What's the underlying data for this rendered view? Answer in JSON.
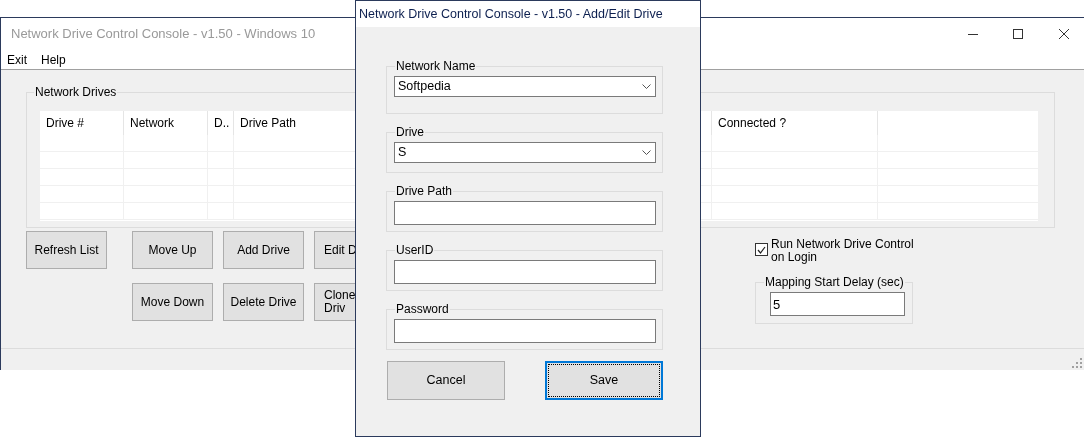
{
  "main_window": {
    "title": "Network Drive Control Console - v1.50 - Windows 10",
    "menu": [
      "Exit",
      "Help"
    ],
    "drives_group": {
      "title": "Network Drives",
      "table": {
        "columns": [
          "Drive #",
          "Network",
          "D..",
          "Drive Path",
          "Connected ?"
        ]
      }
    },
    "buttons": [
      {
        "label": "Refresh List"
      },
      {
        "label": "Move Up"
      },
      {
        "label": "Add Drive"
      },
      {
        "label": "Edit D"
      },
      {
        "label": "Move Down"
      },
      {
        "label": "Delete Drive"
      },
      {
        "label": "Clone\nDriv"
      }
    ],
    "run_on_login": {
      "label": "Run Network Drive Control on Login",
      "checked": true
    },
    "start_delay": {
      "title": "Mapping Start Delay (sec)",
      "value": "5"
    }
  },
  "dialog": {
    "title": "Network Drive Control Console - v1.50 - Add/Edit Drive",
    "fields": [
      {
        "label": "Network Name",
        "kind": "combo",
        "value": "Softpedia"
      },
      {
        "label": "Drive",
        "kind": "combo",
        "value": "S"
      },
      {
        "label": "Drive Path",
        "kind": "text"
      },
      {
        "label": "UserID",
        "kind": "text"
      },
      {
        "label": "Password",
        "kind": "text"
      }
    ],
    "buttons": [
      {
        "label": "Cancel",
        "focused": false
      },
      {
        "label": "Save",
        "focused": true
      }
    ]
  }
}
